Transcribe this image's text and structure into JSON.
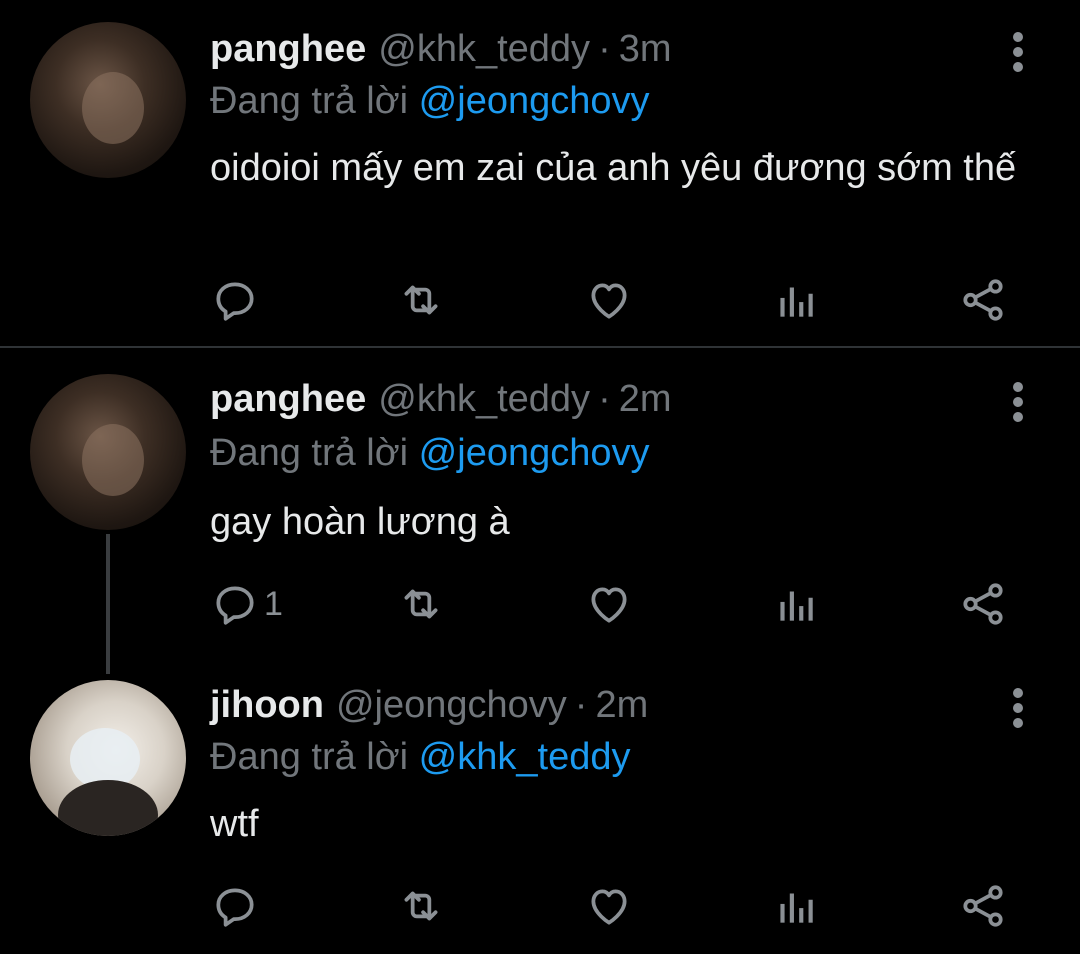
{
  "tweets": [
    {
      "name": "panghee",
      "handle": "@khk_teddy",
      "separator": "·",
      "time": "3m",
      "reply_prefix": "Đang trả lời",
      "reply_to": "@jeongchovy",
      "text": "oidoioi mấy em zai của anh yêu đương sớm thế",
      "reply_count": "",
      "avatar": "dark"
    },
    {
      "name": "panghee",
      "handle": "@khk_teddy",
      "separator": "·",
      "time": "2m",
      "reply_prefix": "Đang trả lời",
      "reply_to": "@jeongchovy",
      "text": "gay hoàn lương à",
      "reply_count": "1",
      "avatar": "dark"
    },
    {
      "name": "jihoon",
      "handle": "@jeongchovy",
      "separator": "·",
      "time": "2m",
      "reply_prefix": "Đang trả lời",
      "reply_to": "@khk_teddy",
      "text": "wtf",
      "reply_count": "",
      "avatar": "light"
    }
  ],
  "icons": {
    "reply": "reply-icon",
    "retweet": "retweet-icon",
    "like": "heart-icon",
    "analytics": "analytics-icon",
    "share": "share-icon",
    "more": "more-vertical-icon"
  },
  "colors": {
    "background": "#000000",
    "name": "#e7e9ea",
    "secondary": "#71767b",
    "mention": "#1d9bf0",
    "icon": "#8b9095"
  }
}
